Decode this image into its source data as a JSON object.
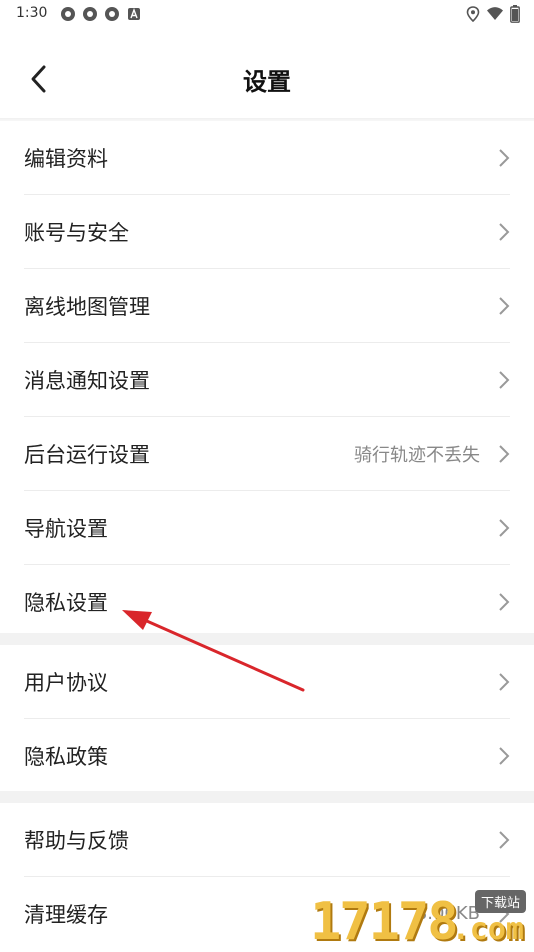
{
  "status_bar": {
    "time": "1:30",
    "left_icons": [
      "app-icon",
      "app-icon",
      "app-icon",
      "a-icon"
    ],
    "right_icons": [
      "location-icon",
      "wifi-icon",
      "battery-icon"
    ]
  },
  "header": {
    "title": "设置"
  },
  "groups": [
    {
      "items": [
        {
          "label": "编辑资料"
        },
        {
          "label": "账号与安全"
        },
        {
          "label": "离线地图管理"
        },
        {
          "label": "消息通知设置"
        },
        {
          "label": "后台运行设置",
          "value": "骑行轨迹不丢失"
        },
        {
          "label": "导航设置"
        },
        {
          "label": "隐私设置"
        }
      ]
    },
    {
      "items": [
        {
          "label": "用户协议"
        },
        {
          "label": "隐私政策"
        }
      ]
    },
    {
      "items": [
        {
          "label": "帮助与反馈"
        },
        {
          "label": "清理缓存",
          "value": "8.00KB"
        }
      ]
    }
  ],
  "watermark": {
    "number": "17178",
    "badge": "下载站",
    "domain": ".com"
  },
  "colors": {
    "annotation_arrow": "#d9262b",
    "divider": "#f2f2f2",
    "secondary_text": "#888888"
  }
}
